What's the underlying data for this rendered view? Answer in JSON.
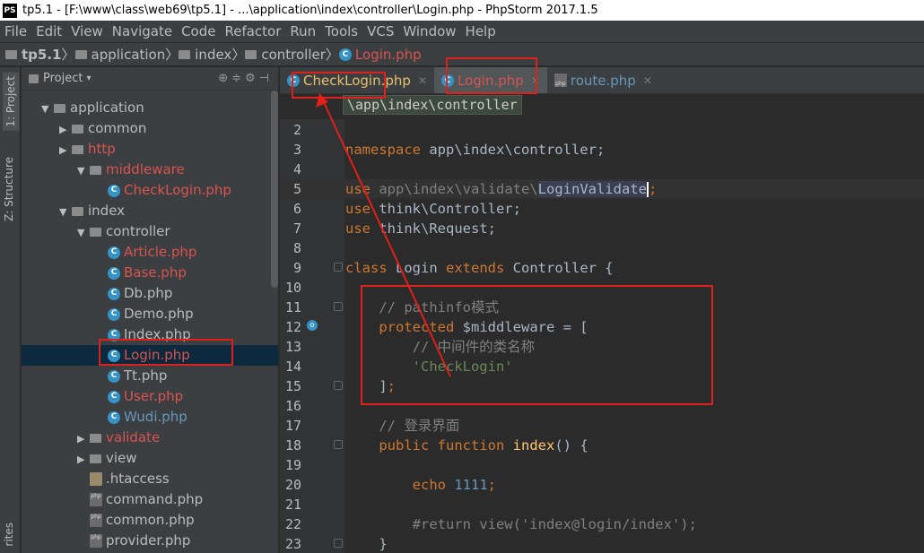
{
  "window": {
    "title": "tp5.1 - [F:\\www\\class\\web69\\tp5.1] - ...\\application\\index\\controller\\Login.php - PhpStorm 2017.1.5",
    "logo": "PS"
  },
  "menu": [
    "File",
    "Edit",
    "View",
    "Navigate",
    "Code",
    "Refactor",
    "Run",
    "Tools",
    "VCS",
    "Window",
    "Help"
  ],
  "breadcrumb": [
    "tp5.1",
    "application",
    "index",
    "controller",
    "Login.php"
  ],
  "sidebar_tabs": {
    "project": "1: Project",
    "structure": "Z: Structure",
    "favorites": "rites"
  },
  "project_panel": {
    "title": "Project"
  },
  "tree": [
    {
      "label": "application",
      "depth": 1,
      "type": "folder",
      "open": true,
      "color": "gray"
    },
    {
      "label": "common",
      "depth": 2,
      "type": "folder",
      "open": false,
      "color": "gray"
    },
    {
      "label": "http",
      "depth": 2,
      "type": "folder",
      "open": false,
      "color": "red"
    },
    {
      "label": "middleware",
      "depth": 3,
      "type": "folder",
      "open": true,
      "color": "red"
    },
    {
      "label": "CheckLogin.php",
      "depth": 4,
      "type": "class",
      "color": "red"
    },
    {
      "label": "index",
      "depth": 2,
      "type": "folder",
      "open": true,
      "color": "gray"
    },
    {
      "label": "controller",
      "depth": 3,
      "type": "folder",
      "open": true,
      "color": "gray"
    },
    {
      "label": "Article.php",
      "depth": 4,
      "type": "class",
      "color": "red"
    },
    {
      "label": "Base.php",
      "depth": 4,
      "type": "class",
      "color": "red"
    },
    {
      "label": "Db.php",
      "depth": 4,
      "type": "class",
      "color": "gray"
    },
    {
      "label": "Demo.php",
      "depth": 4,
      "type": "class",
      "color": "gray"
    },
    {
      "label": "Index.php",
      "depth": 4,
      "type": "class",
      "color": "gray"
    },
    {
      "label": "Login.php",
      "depth": 4,
      "type": "class",
      "color": "red",
      "selected": true
    },
    {
      "label": "Tt.php",
      "depth": 4,
      "type": "class",
      "color": "gray"
    },
    {
      "label": "User.php",
      "depth": 4,
      "type": "class",
      "color": "red"
    },
    {
      "label": "Wudi.php",
      "depth": 4,
      "type": "class",
      "color": "blue"
    },
    {
      "label": "validate",
      "depth": 3,
      "type": "folder",
      "open": false,
      "color": "red"
    },
    {
      "label": "view",
      "depth": 3,
      "type": "folder",
      "open": false,
      "color": "gray"
    },
    {
      "label": ".htaccess",
      "depth": 3,
      "type": "file",
      "color": "gray"
    },
    {
      "label": "command.php",
      "depth": 3,
      "type": "php",
      "color": "gray"
    },
    {
      "label": "common.php",
      "depth": 3,
      "type": "php",
      "color": "gray"
    },
    {
      "label": "provider.php",
      "depth": 3,
      "type": "php",
      "color": "gray"
    }
  ],
  "tabs": [
    {
      "label": "CheckLogin.php",
      "icon": "class-icon",
      "color": "#e8bf6a"
    },
    {
      "label": "Login.php",
      "icon": "class-icon",
      "color": "#d9534f",
      "active": true
    },
    {
      "label": "route.php",
      "icon": "php-icon",
      "color": "#6897bb"
    }
  ],
  "path_popup": "\\app\\index\\controller",
  "code_lines": [
    {
      "n": "2",
      "html": ""
    },
    {
      "n": "3",
      "html": "<span class='kw'>namespace</span> app\\index\\controller;"
    },
    {
      "n": "4",
      "html": ""
    },
    {
      "n": "5",
      "html": "<span class='kw'>use</span> <span class='cm'>app\\index\\validate\\</span><span style='background:#3b3f54;color:#a9b7c6'>LoginValidate</span><span class='caret'></span><span class='kw'>;</span>"
    },
    {
      "n": "6",
      "html": "<span class='kw'>use</span> think\\Controller;"
    },
    {
      "n": "7",
      "html": "<span class='kw'>use</span> think\\Request;"
    },
    {
      "n": "8",
      "html": ""
    },
    {
      "n": "9",
      "html": "<span class='kw'>class</span> Login <span class='kw'>extends</span> Controller {"
    },
    {
      "n": "10",
      "html": ""
    },
    {
      "n": "11",
      "html": "    <span class='cm'>// pathinfo模式</span>"
    },
    {
      "n": "12",
      "html": "    <span class='kw'>protected</span> $middleware = ["
    },
    {
      "n": "13",
      "html": "        <span class='cm'>// 中间件的类名称</span>"
    },
    {
      "n": "14",
      "html": "        <span class='str'>'CheckLogin'</span>"
    },
    {
      "n": "15",
      "html": "    ]<span class='kw'>;</span>"
    },
    {
      "n": "16",
      "html": ""
    },
    {
      "n": "17",
      "html": "    <span class='cm'>// 登录界面</span>"
    },
    {
      "n": "18",
      "html": "    <span class='kw'>public function</span> <span class='fn'>index</span>() {"
    },
    {
      "n": "19",
      "html": ""
    },
    {
      "n": "20",
      "html": "        <span class='kw'>echo</span> <span class='num'>1111</span><span class='kw'>;</span>"
    },
    {
      "n": "21",
      "html": ""
    },
    {
      "n": "22",
      "html": "        <span class='cm'>#return view('index@login/index');</span>"
    },
    {
      "n": "23",
      "html": "    }"
    }
  ]
}
